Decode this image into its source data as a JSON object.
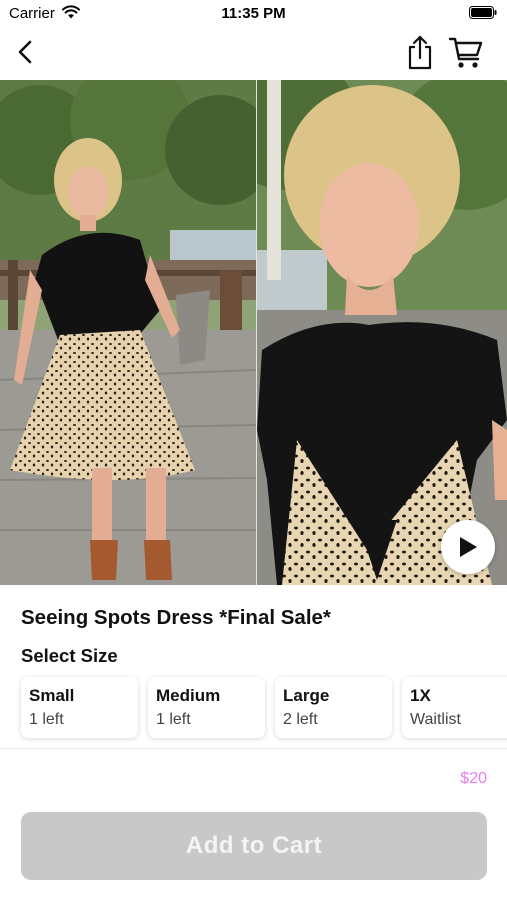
{
  "status_bar": {
    "carrier": "Carrier",
    "time": "11:35 PM"
  },
  "nav": {
    "back_icon": "chevron-left-icon",
    "share_icon": "share-icon",
    "cart_icon": "cart-icon"
  },
  "gallery": {
    "play_icon": "play-icon"
  },
  "product": {
    "title": "Seeing Spots Dress *Final Sale*",
    "select_size_label": "Select Size",
    "price": "$20"
  },
  "sizes": [
    {
      "name": "Small",
      "stock": "1 left"
    },
    {
      "name": "Medium",
      "stock": "1 left"
    },
    {
      "name": "Large",
      "stock": "2 left"
    },
    {
      "name": "1X",
      "stock": "Waitlist"
    }
  ],
  "cta": {
    "label": "Add to Cart"
  },
  "colors": {
    "price": "#e87df0",
    "button_disabled": "#c8c8c8"
  }
}
